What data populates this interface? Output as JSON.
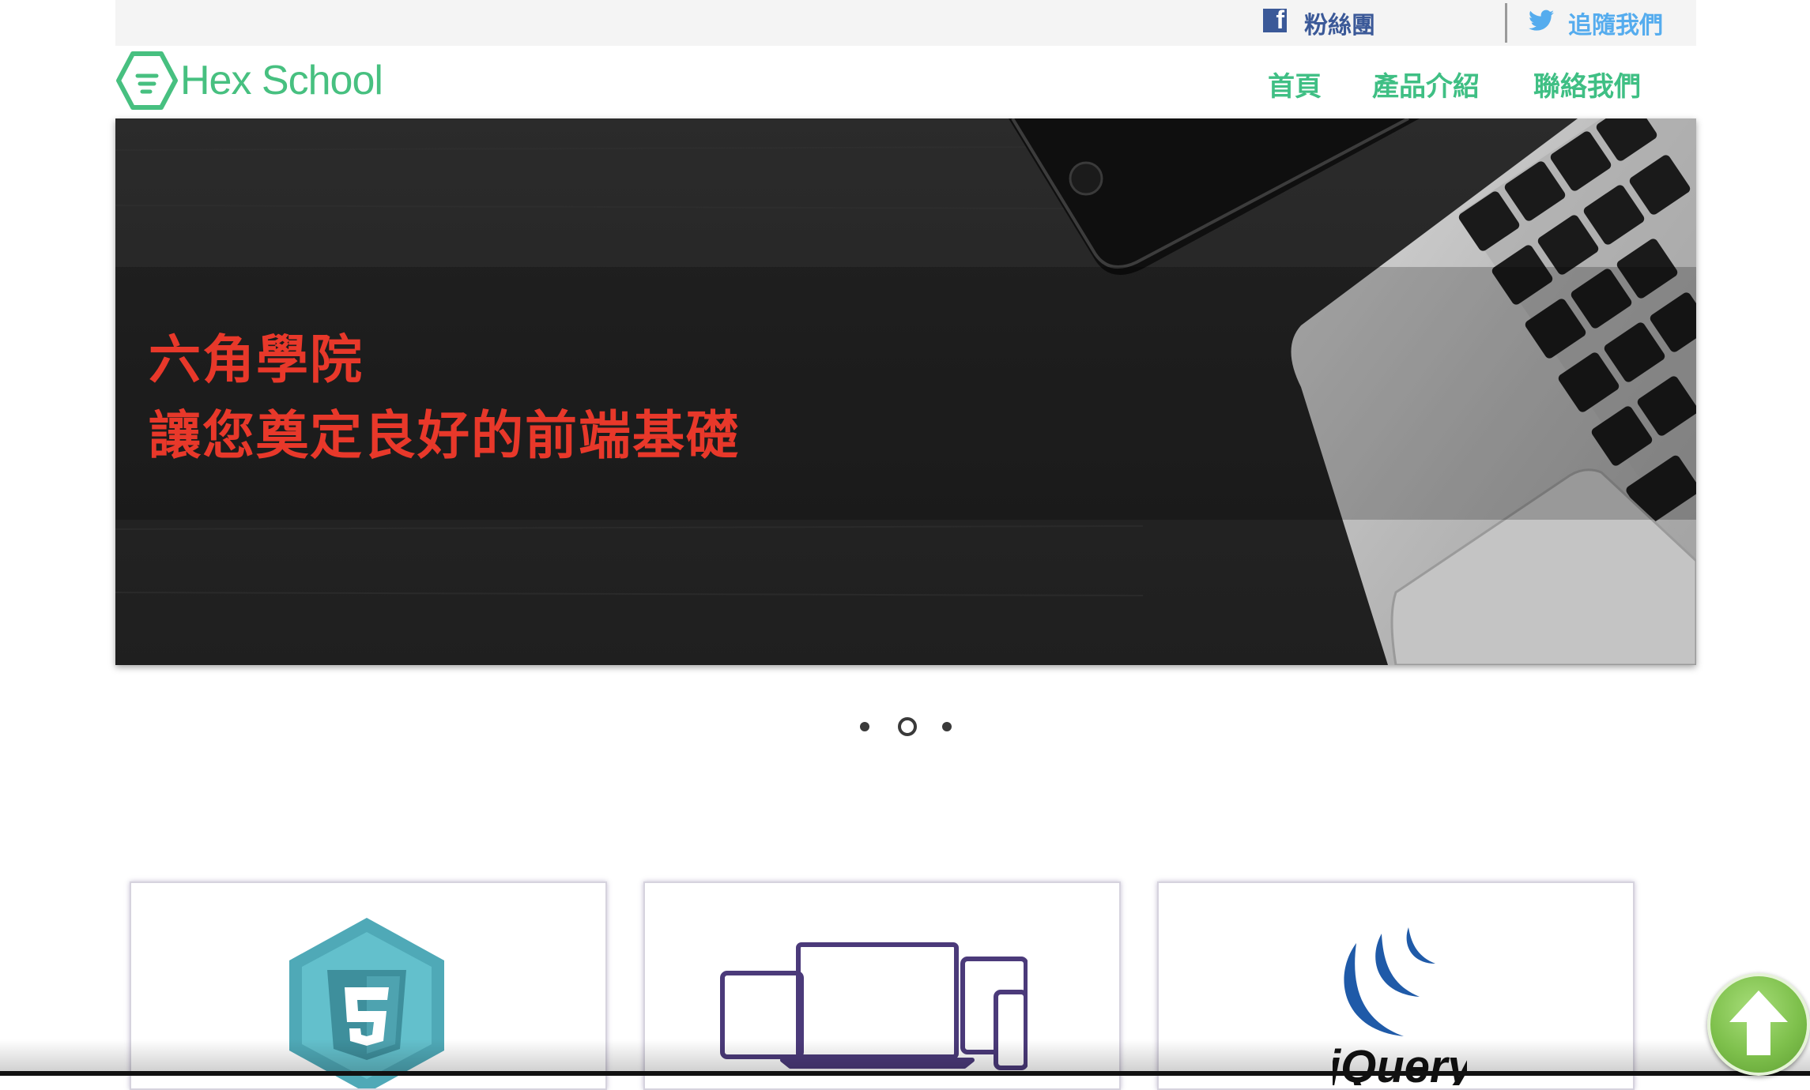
{
  "social": {
    "facebook_label": "粉絲團",
    "twitter_label": "追隨我們"
  },
  "brand": {
    "name": "Hex School"
  },
  "nav": {
    "items": [
      {
        "label": "首頁"
      },
      {
        "label": "產品介紹"
      },
      {
        "label": "聯絡我們"
      }
    ]
  },
  "banner": {
    "line1": "六角學院",
    "line2": "讓您奠定良好的前端基礎"
  },
  "carousel": {
    "slide_count": 3,
    "active_index": 1
  },
  "cards": [
    {
      "icon": "html5-badge-icon"
    },
    {
      "icon": "responsive-devices-icon"
    },
    {
      "icon": "jquery-logo-icon",
      "logo_text": "jQuery"
    }
  ],
  "colors": {
    "brand_green": "#47c080",
    "nav_green": "#3fbf84",
    "banner_text": "#e8382a",
    "facebook": "#3b5998",
    "twitter": "#55acee"
  }
}
